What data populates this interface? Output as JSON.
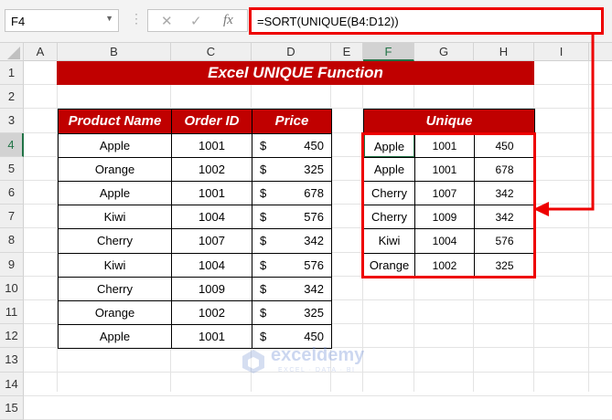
{
  "formula_bar": {
    "name_box": "F4",
    "cancel": "✕",
    "enter": "✓",
    "fx": "fx",
    "formula": "=SORT(UNIQUE(B4:D12))"
  },
  "columns": [
    "A",
    "B",
    "C",
    "D",
    "E",
    "F",
    "G",
    "H",
    "I"
  ],
  "rows": [
    "1",
    "2",
    "3",
    "4",
    "5",
    "6",
    "7",
    "8",
    "9",
    "10",
    "11",
    "12",
    "13",
    "14",
    "15"
  ],
  "selected_cell": "F4",
  "title": "Excel UNIQUE Function",
  "source_table": {
    "headers": [
      "Product Name",
      "Order ID",
      "Price"
    ],
    "currency": "$",
    "rows": [
      [
        "Apple",
        "1001",
        "450"
      ],
      [
        "Orange",
        "1002",
        "325"
      ],
      [
        "Apple",
        "1001",
        "678"
      ],
      [
        "Kiwi",
        "1004",
        "576"
      ],
      [
        "Cherry",
        "1007",
        "342"
      ],
      [
        "Kiwi",
        "1004",
        "576"
      ],
      [
        "Cherry",
        "1009",
        "342"
      ],
      [
        "Orange",
        "1002",
        "325"
      ],
      [
        "Apple",
        "1001",
        "450"
      ]
    ]
  },
  "unique_table": {
    "header": "Unique",
    "rows": [
      [
        "Apple",
        "1001",
        "450"
      ],
      [
        "Apple",
        "1001",
        "678"
      ],
      [
        "Cherry",
        "1007",
        "342"
      ],
      [
        "Cherry",
        "1009",
        "342"
      ],
      [
        "Kiwi",
        "1004",
        "576"
      ],
      [
        "Orange",
        "1002",
        "325"
      ]
    ]
  },
  "watermark": {
    "name": "exceldemy",
    "tagline": "EXCEL · DATA · BI"
  },
  "colors": {
    "accent": "#c00000",
    "highlight": "#ee0000",
    "excel_green": "#217346"
  }
}
